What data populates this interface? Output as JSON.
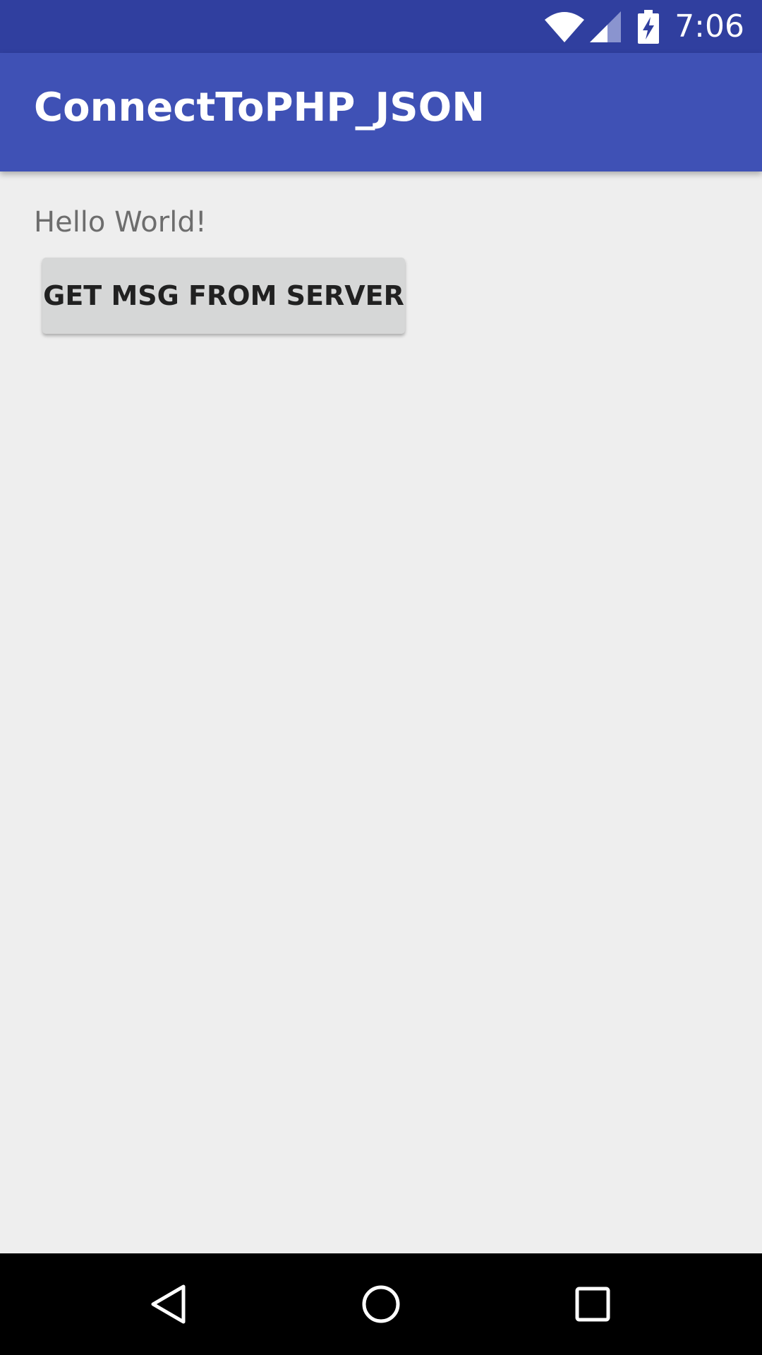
{
  "status_bar": {
    "time": "7:06",
    "icons": [
      "wifi-icon",
      "cell-signal-icon",
      "battery-charging-icon"
    ],
    "color": "#303f9f"
  },
  "app_bar": {
    "title": "ConnectToPHP_JSON",
    "color": "#3f51b5"
  },
  "main": {
    "message": "Hello World!",
    "button_label": "GET MSG FROM SERVER"
  },
  "nav_bar": {
    "icons": [
      "back-icon",
      "home-icon",
      "recents-icon"
    ]
  }
}
